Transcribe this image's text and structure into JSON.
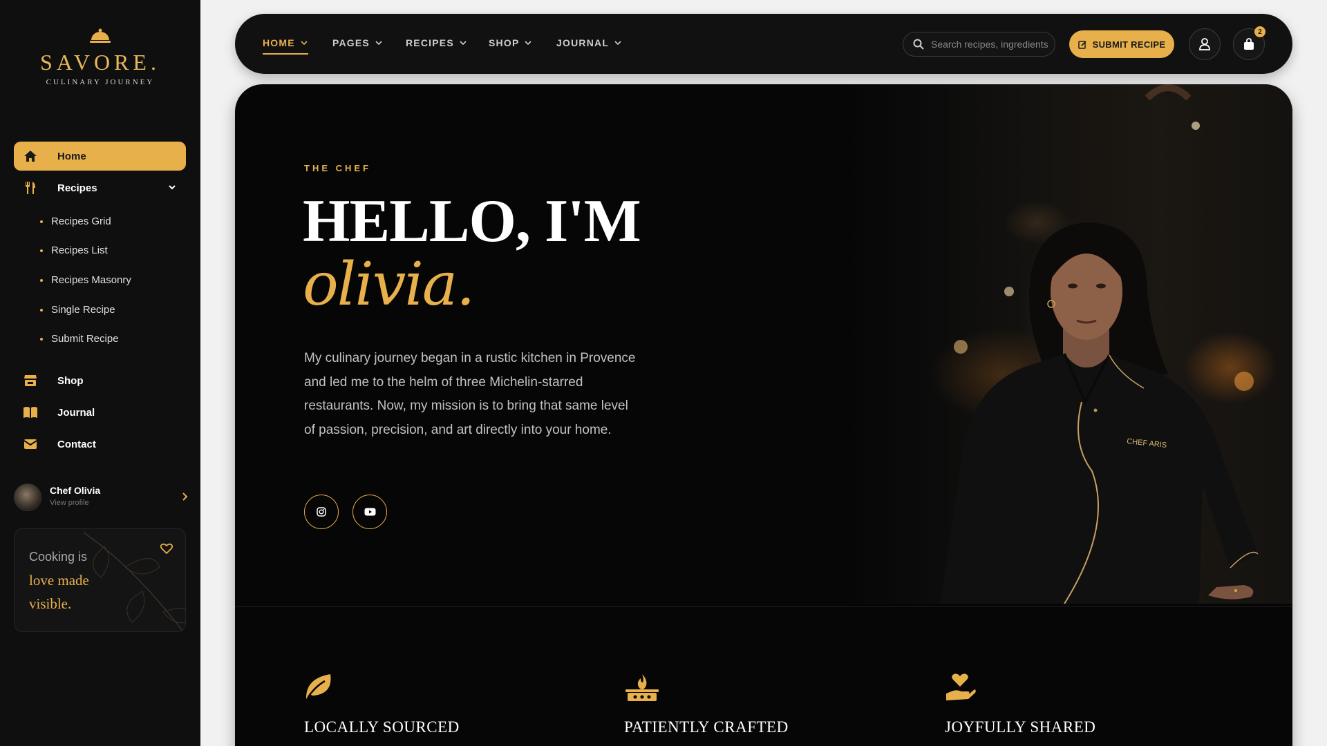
{
  "brand": {
    "name": "SAVORE.",
    "tagline": "CULINARY JOURNEY"
  },
  "sidebar": {
    "items": [
      {
        "label": "Home",
        "icon": "home-icon",
        "active": true
      },
      {
        "label": "Recipes",
        "icon": "utensils-icon",
        "expanded": true
      },
      {
        "label": "Shop",
        "icon": "store-icon"
      },
      {
        "label": "Journal",
        "icon": "book-open-icon"
      },
      {
        "label": "Contact",
        "icon": "envelope-icon"
      }
    ],
    "recipes_sub": [
      "Recipes Grid",
      "Recipes List",
      "Recipes Masonry",
      "Single Recipe",
      "Submit Recipe"
    ],
    "profile": {
      "name": "Chef Olivia",
      "sub": "View profile"
    },
    "quote": {
      "line1": "Cooking is",
      "line2": "love made",
      "line3": "visible."
    }
  },
  "topnav": {
    "items": [
      {
        "label": "HOME",
        "active": true
      },
      {
        "label": "PAGES"
      },
      {
        "label": "RECIPES"
      },
      {
        "label": "SHOP"
      },
      {
        "label": "JOURNAL"
      }
    ],
    "search_placeholder": "Search recipes, ingredients...",
    "submit_label": "SUBMIT RECIPE",
    "cart_count": "2"
  },
  "hero": {
    "eyebrow": "THE CHEF",
    "headline": "HELLO, I'M",
    "name": "olivia.",
    "bio": "My culinary journey began in a rustic kitchen in Provence and led me to the helm of three Michelin-starred restaurants. Now, my mission is to bring that same level of passion, precision, and art directly into your home.",
    "social": [
      "instagram-icon",
      "youtube-icon"
    ],
    "photo_badge": "CHEF ARIS"
  },
  "features": [
    {
      "title": "LOCALLY SOURCED",
      "icon": "leaf-icon"
    },
    {
      "title": "PATIENTLY CRAFTED",
      "icon": "stove-flame-icon"
    },
    {
      "title": "JOYFULLY SHARED",
      "icon": "hand-heart-icon"
    }
  ],
  "colors": {
    "accent": "#e8b04b",
    "background": "#060606",
    "sidebar": "#0f0f0f"
  }
}
